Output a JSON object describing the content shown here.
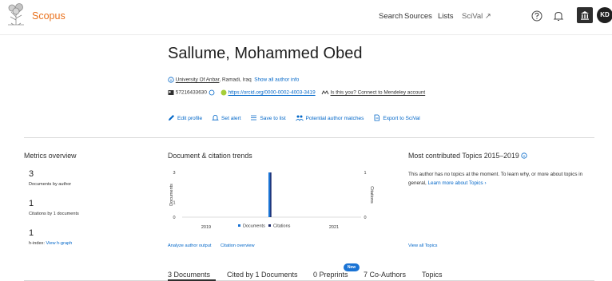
{
  "header": {
    "logo_text": "Scopus",
    "nav": [
      "Search",
      "Sources",
      "Lists",
      "SciVal ↗"
    ],
    "avatar_initials": "KD"
  },
  "author": {
    "name": "Sallume, Mohammed Obed",
    "affiliation": "University Of Anbar",
    "location": ", Ramadi, Iraq",
    "show_all": "Show all author info",
    "author_id": "57216433630",
    "orcid": "https://orcid.org/0000-0002-4003-3419",
    "mendeley": "Is this you? Connect to Mendeley account"
  },
  "actions": [
    "Edit profile",
    "Set alert",
    "Save to list",
    "Potential author matches",
    "Export to SciVal"
  ],
  "metrics": {
    "title": "Metrics overview",
    "documents_value": "3",
    "documents_label": "Documents by author",
    "citations_value": "1",
    "citations_label": "Citations by 1 documents",
    "hindex_value": "1",
    "hindex_label": "h-index:",
    "hgraph_link": "View h-graph"
  },
  "trends": {
    "title": "Document & citation trends",
    "analyze_link": "Analyze author output",
    "citation_link": "Citation overview"
  },
  "chart_data": {
    "type": "bar",
    "categories": [
      "2019",
      "2020",
      "2021"
    ],
    "series": [
      {
        "name": "Documents",
        "values": [
          0,
          3,
          0
        ],
        "color": "#1a73d4"
      },
      {
        "name": "Citations",
        "values": [
          0,
          1,
          0
        ],
        "color": "#1b2a6b"
      }
    ],
    "ylabel": "Documents",
    "y2label": "Citations",
    "ylim": [
      0,
      3
    ],
    "y2lim": [
      0,
      1
    ],
    "left_ticks": [
      "3",
      "1",
      "0"
    ],
    "right_ticks": [
      "1",
      "0"
    ],
    "xtick_labels": [
      "2019",
      "2021"
    ],
    "legend_position": "bottom"
  },
  "topics": {
    "title": "Most contributed Topics 2015–2019",
    "text": "This author has no topics at the moment. To learn why, or more about topics in general,",
    "learn_more": "Learn more about Topics ›",
    "view_all": "View all Topics"
  },
  "tabs": {
    "items": [
      "3 Documents",
      "Cited by 1 Documents",
      "0 Preprints",
      "7 Co-Authors",
      "Topics"
    ],
    "new_badge": "New"
  },
  "colors": {
    "brand": "#e9711c",
    "link": "#0066c8",
    "documents_bar": "#1a73d4",
    "citations_bar": "#1b2a6b"
  }
}
